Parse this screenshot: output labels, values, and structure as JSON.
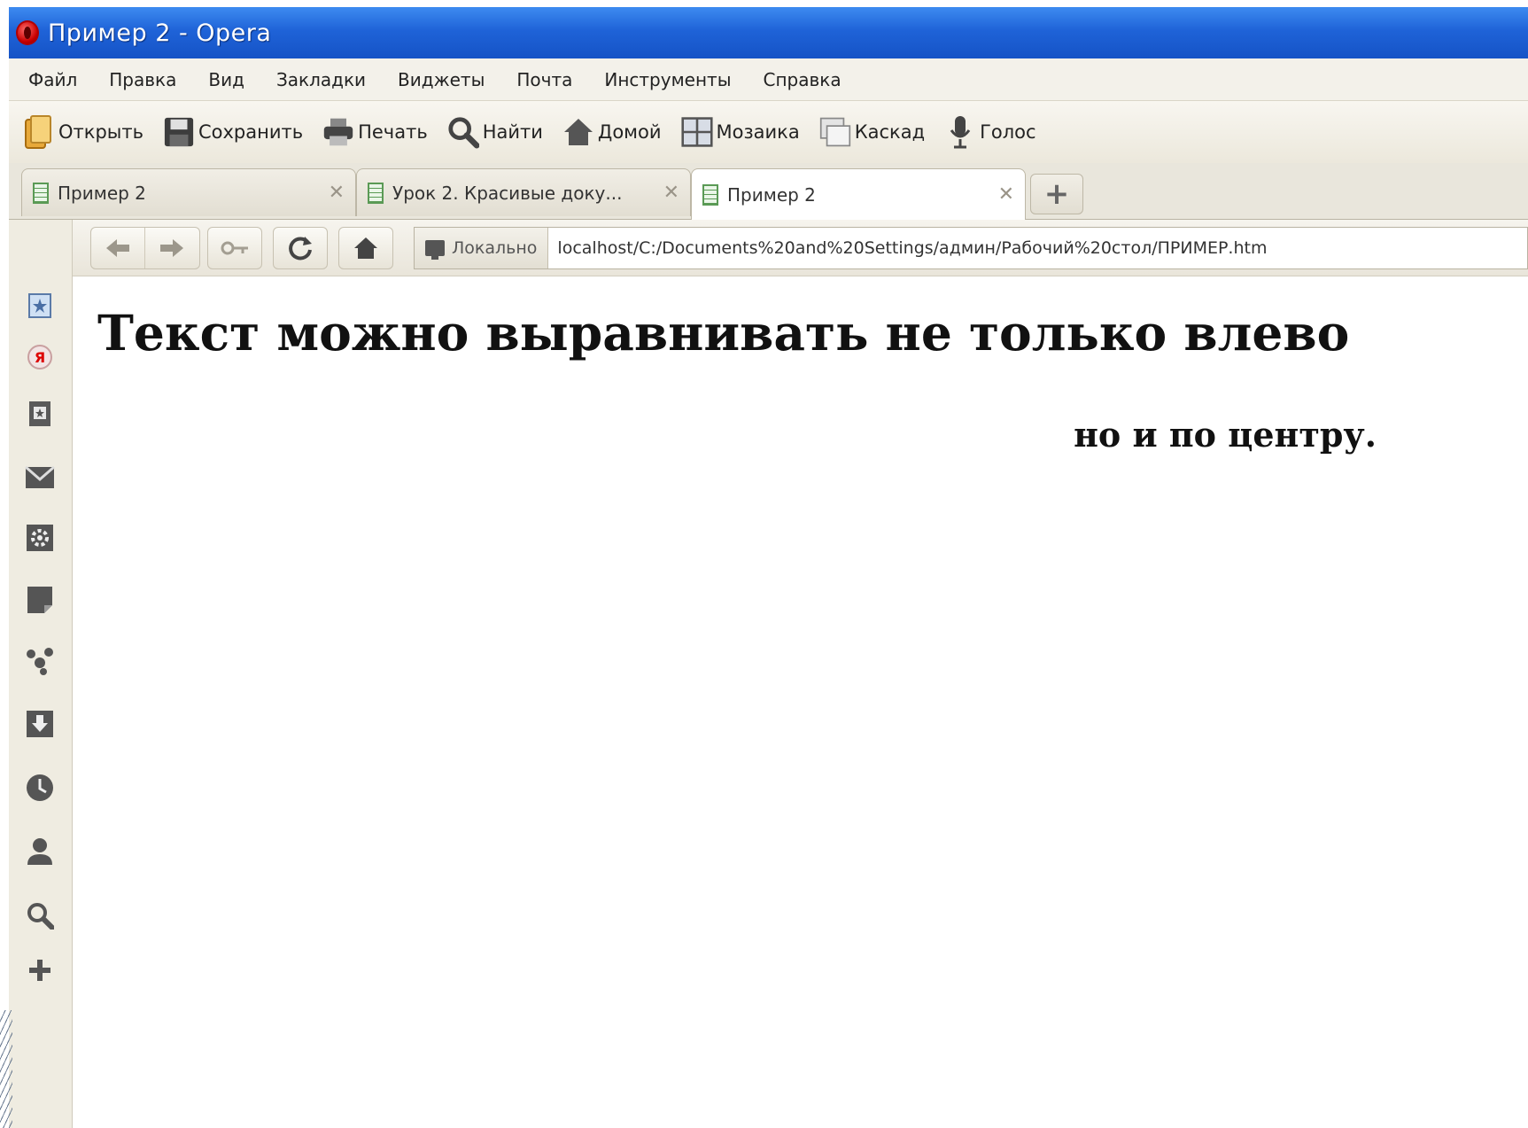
{
  "window": {
    "title": "Пример 2 - Opera"
  },
  "menu": [
    "Файл",
    "Правка",
    "Вид",
    "Закладки",
    "Виджеты",
    "Почта",
    "Инструменты",
    "Справка"
  ],
  "toolbar": {
    "open": "Открыть",
    "save": "Сохранить",
    "print": "Печать",
    "find": "Найти",
    "home": "Домой",
    "tile": "Мозаика",
    "cascade": "Каскад",
    "voice": "Голос"
  },
  "tabs": [
    {
      "label": "Пример 2",
      "active": false
    },
    {
      "label": "Урок 2. Красивые доку...",
      "active": false
    },
    {
      "label": "Пример 2",
      "active": true
    }
  ],
  "address": {
    "badge": "Локально",
    "url": "localhost/C:/Documents%20and%20Settings/админ/Рабочий%20стол/ПРИМЕР.htm"
  },
  "page": {
    "heading": "Текст можно выравнивать не только влево",
    "right_text": "но и по центру."
  },
  "colors": {
    "titlebar": "#1f63d8",
    "chrome": "#efece1",
    "tab_icon": "#5a9a55"
  },
  "panel_icons": [
    "bookmarks-icon",
    "yandex-icon",
    "speed-dial-icon",
    "mail-icon",
    "widgets-icon",
    "notes-icon",
    "unite-icon",
    "downloads-icon",
    "history-icon",
    "contacts-icon",
    "search-icon",
    "add-panel-icon"
  ]
}
